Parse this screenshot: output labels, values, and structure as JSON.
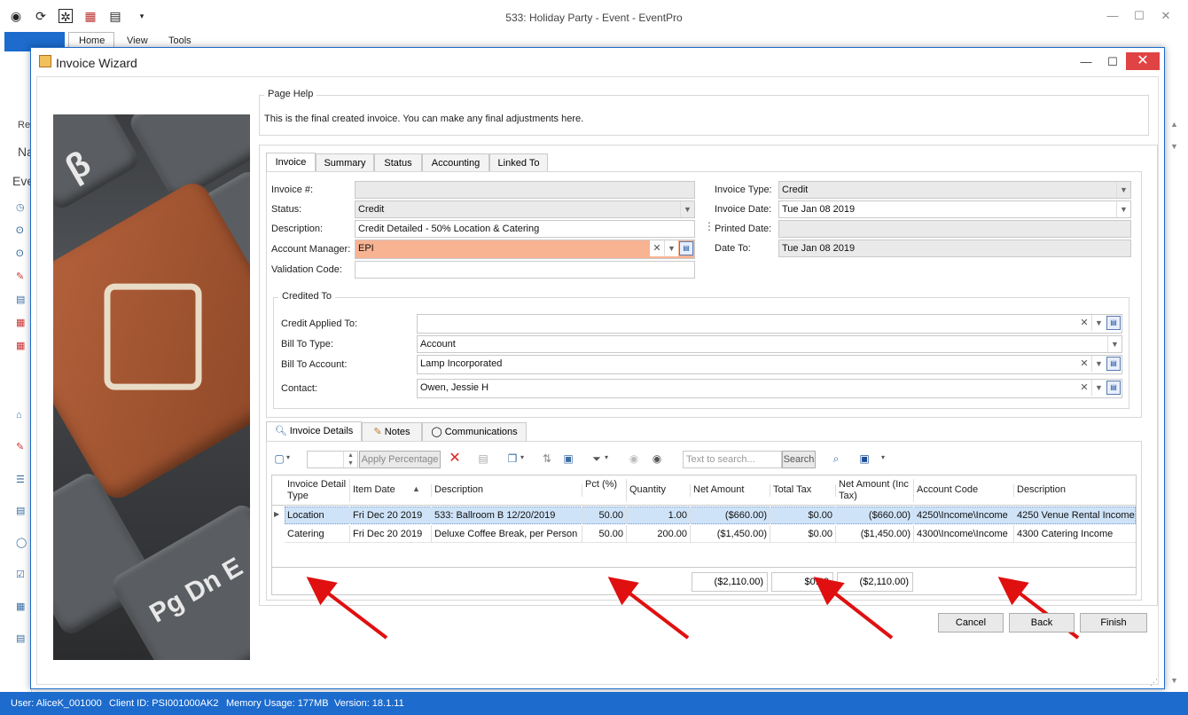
{
  "app": {
    "title": "533: Holiday Party - Event - EventPro",
    "ribbon_tabs": [
      "Home",
      "View",
      "Tools"
    ],
    "left_fragments": [
      "Re",
      "Na",
      "Eve"
    ]
  },
  "dialog": {
    "title": "Invoice Wizard",
    "page_help": {
      "legend": "Page Help",
      "text": "This is the final created invoice.  You can make any final adjustments here."
    },
    "tabs": [
      "Invoice",
      "Summary",
      "Status",
      "Accounting",
      "Linked To"
    ],
    "fields": {
      "invoice_no_label": "Invoice #:",
      "invoice_no_value": "",
      "status_label": "Status:",
      "status_value": "Credit",
      "description_label": "Description:",
      "description_value": "Credit Detailed - 50% Location & Catering",
      "account_manager_label": "Account Manager:",
      "account_manager_value": "EPI",
      "validation_code_label": "Validation Code:",
      "validation_code_value": "",
      "invoice_type_label": "Invoice Type:",
      "invoice_type_value": "Credit",
      "invoice_date_label": "Invoice Date:",
      "invoice_date_value": "Tue Jan 08 2019",
      "printed_date_label": "Printed Date:",
      "printed_date_value": "",
      "date_to_label": "Date To:",
      "date_to_value": "Tue Jan 08 2019"
    },
    "credited_to": {
      "legend": "Credited To",
      "credit_applied_label": "Credit Applied To:",
      "credit_applied_value": "",
      "bill_to_type_label": "Bill To Type:",
      "bill_to_type_value": "Account",
      "bill_to_account_label": "Bill To Account:",
      "bill_to_account_value": "Lamp Incorporated",
      "contact_label": "Contact:",
      "contact_value": "Owen, Jessie H"
    },
    "detail_tabs": [
      "Invoice Details",
      "Notes",
      "Communications"
    ],
    "toolbar": {
      "apply_percentage": "Apply Percentage",
      "search_placeholder": "Text to search...",
      "search_button": "Search"
    },
    "grid": {
      "headers": [
        "Invoice Detail Type",
        "Item Date",
        "Description",
        "Pct (%)",
        "Quantity",
        "Net Amount",
        "Total Tax",
        "Net Amount (Inc Tax)",
        "Account Code",
        "Description"
      ],
      "rows": [
        [
          "Location",
          "Fri Dec 20 2019",
          "533: Ballroom B 12/20/2019",
          "50.00",
          "1.00",
          "($660.00)",
          "$0.00",
          "($660.00)",
          "4250\\Income\\Income",
          "4250 Venue Rental Income"
        ],
        [
          "Catering",
          "Fri Dec 20 2019",
          "Deluxe Coffee Break, per Person",
          "50.00",
          "200.00",
          "($1,450.00)",
          "$0.00",
          "($1,450.00)",
          "4300\\Income\\Income",
          "4300 Catering Income"
        ]
      ],
      "totals": {
        "net_amount": "($2,110.00)",
        "total_tax": "$0.00",
        "net_inc_tax": "($2,110.00)"
      }
    },
    "buttons": {
      "cancel": "Cancel",
      "back": "Back",
      "finish": "Finish"
    }
  },
  "status_bar": {
    "user": "User: AliceK_001000",
    "client_id": "Client ID: PSI001000AK2",
    "memory": "Memory Usage: 177MB",
    "version": "Version: 18.1.11"
  },
  "image": {
    "keys": [
      "β",
      "Pg Dn E"
    ]
  },
  "colors": {
    "accent": "#1c6bcd",
    "highlight_field": "#f8b393",
    "selected_row": "#cfe3f8",
    "arrow": "#e01010"
  }
}
